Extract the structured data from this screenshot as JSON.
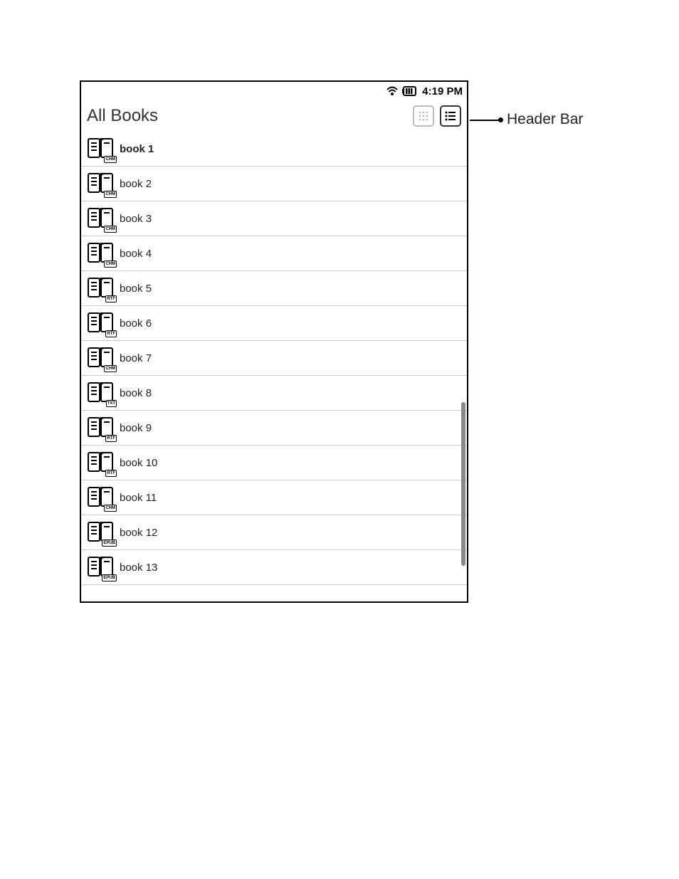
{
  "status": {
    "time": "4:19 PM"
  },
  "header": {
    "title": "All Books"
  },
  "callout": {
    "label": "Header Bar"
  },
  "books": [
    {
      "title": "book 1",
      "format": "CHM",
      "bold": true
    },
    {
      "title": "book 2",
      "format": "CHM",
      "bold": false
    },
    {
      "title": "book 3",
      "format": "CHM",
      "bold": false
    },
    {
      "title": "book 4",
      "format": "CHM",
      "bold": false
    },
    {
      "title": "book 5",
      "format": "RTF",
      "bold": false
    },
    {
      "title": "book 6",
      "format": "RTF",
      "bold": false
    },
    {
      "title": "book 7",
      "format": "CHM",
      "bold": false
    },
    {
      "title": "book 8",
      "format": "TXT",
      "bold": false
    },
    {
      "title": "book 9",
      "format": "RTF",
      "bold": false
    },
    {
      "title": "book 10",
      "format": "RTF",
      "bold": false
    },
    {
      "title": "book 11",
      "format": "CHM",
      "bold": false
    },
    {
      "title": "book 12",
      "format": "EPUB",
      "bold": false
    },
    {
      "title": "book 13",
      "format": "EPUB",
      "bold": false
    }
  ]
}
